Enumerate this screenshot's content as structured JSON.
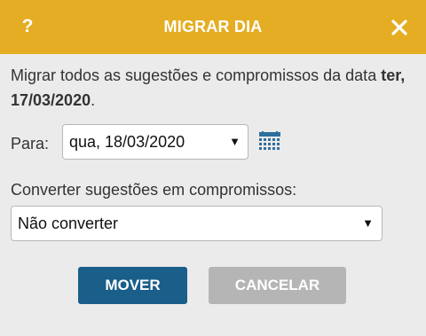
{
  "dialog": {
    "title": "MIGRAR DIA",
    "help_glyph": "?",
    "help_icon": "question-mark-icon",
    "close_icon": "close-x-icon",
    "header_color": "#e5ad23"
  },
  "message": {
    "text": "Migrar todos as sugestões e compromissos da data ",
    "date": "ter, 17/03/2020",
    "suffix": "."
  },
  "target_date": {
    "label": "Para:",
    "value": "qua, 18/03/2020",
    "calendar_icon": "calendar-icon"
  },
  "convert": {
    "label": "Converter sugestões em compromissos:",
    "value": "Não converter"
  },
  "buttons": {
    "move_label": "MOVER",
    "move_color": "#1a5e8a",
    "cancel_label": "CANCELAR",
    "cancel_color": "#b5b5b5"
  },
  "caret_glyph": "▼"
}
